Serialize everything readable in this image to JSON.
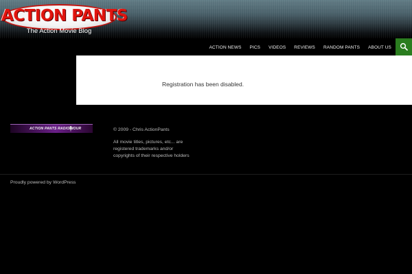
{
  "header": {
    "site_title": "ACTION PANTS",
    "tagline": "The Action Movie Blog",
    "logo_color": "#e0140e"
  },
  "nav": {
    "items": [
      {
        "label": "ACTION NEWS"
      },
      {
        "label": "PICS"
      },
      {
        "label": "VIDEOS"
      },
      {
        "label": "REVIEWS"
      },
      {
        "label": "RANDOM PANTS"
      },
      {
        "label": "ABOUT US"
      }
    ],
    "search_icon": "search-icon",
    "search_color": "#2a7d1f"
  },
  "main": {
    "message": "Registration has been disabled."
  },
  "footer": {
    "radio_banner_text": "ACTION PANTS RADIO HOUR",
    "radio_icon": "microphone-icon",
    "copyright": "© 2009 - Chris ActionPants",
    "legal_lines": [
      "All movie titles, pictures, etc... are",
      "registered trademarks and/or",
      "copyrights of their respective holders"
    ],
    "powered_by": "Proudly powered by WordPress"
  }
}
